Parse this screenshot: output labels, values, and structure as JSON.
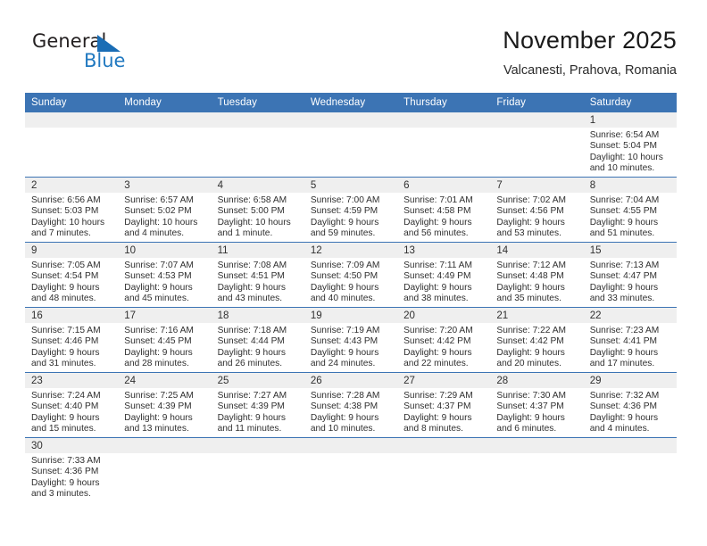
{
  "brand": {
    "name_line1": "General",
    "name_line2": "Blue",
    "mark": "triangle-flag-icon",
    "accent_color": "#2179c0"
  },
  "header": {
    "title": "November 2025",
    "location": "Valcanesti, Prahova, Romania"
  },
  "colors": {
    "header_blue": "#3c74b4",
    "daynum_strip": "#efefef",
    "text": "#2f2f2f"
  },
  "calendar": {
    "weekday_headers": [
      "Sunday",
      "Monday",
      "Tuesday",
      "Wednesday",
      "Thursday",
      "Friday",
      "Saturday"
    ],
    "labels": {
      "sunrise": "Sunrise:",
      "sunset": "Sunset:",
      "daylight": "Daylight:"
    },
    "weeks": [
      [
        {
          "day": "",
          "empty": true
        },
        {
          "day": "",
          "empty": true
        },
        {
          "day": "",
          "empty": true
        },
        {
          "day": "",
          "empty": true
        },
        {
          "day": "",
          "empty": true
        },
        {
          "day": "",
          "empty": true
        },
        {
          "day": "1",
          "sunrise": "Sunrise: 6:54 AM",
          "sunset": "Sunset: 5:04 PM",
          "daylight": "Daylight: 10 hours and 10 minutes."
        }
      ],
      [
        {
          "day": "2",
          "sunrise": "Sunrise: 6:56 AM",
          "sunset": "Sunset: 5:03 PM",
          "daylight": "Daylight: 10 hours and 7 minutes."
        },
        {
          "day": "3",
          "sunrise": "Sunrise: 6:57 AM",
          "sunset": "Sunset: 5:02 PM",
          "daylight": "Daylight: 10 hours and 4 minutes."
        },
        {
          "day": "4",
          "sunrise": "Sunrise: 6:58 AM",
          "sunset": "Sunset: 5:00 PM",
          "daylight": "Daylight: 10 hours and 1 minute."
        },
        {
          "day": "5",
          "sunrise": "Sunrise: 7:00 AM",
          "sunset": "Sunset: 4:59 PM",
          "daylight": "Daylight: 9 hours and 59 minutes."
        },
        {
          "day": "6",
          "sunrise": "Sunrise: 7:01 AM",
          "sunset": "Sunset: 4:58 PM",
          "daylight": "Daylight: 9 hours and 56 minutes."
        },
        {
          "day": "7",
          "sunrise": "Sunrise: 7:02 AM",
          "sunset": "Sunset: 4:56 PM",
          "daylight": "Daylight: 9 hours and 53 minutes."
        },
        {
          "day": "8",
          "sunrise": "Sunrise: 7:04 AM",
          "sunset": "Sunset: 4:55 PM",
          "daylight": "Daylight: 9 hours and 51 minutes."
        }
      ],
      [
        {
          "day": "9",
          "sunrise": "Sunrise: 7:05 AM",
          "sunset": "Sunset: 4:54 PM",
          "daylight": "Daylight: 9 hours and 48 minutes."
        },
        {
          "day": "10",
          "sunrise": "Sunrise: 7:07 AM",
          "sunset": "Sunset: 4:53 PM",
          "daylight": "Daylight: 9 hours and 45 minutes."
        },
        {
          "day": "11",
          "sunrise": "Sunrise: 7:08 AM",
          "sunset": "Sunset: 4:51 PM",
          "daylight": "Daylight: 9 hours and 43 minutes."
        },
        {
          "day": "12",
          "sunrise": "Sunrise: 7:09 AM",
          "sunset": "Sunset: 4:50 PM",
          "daylight": "Daylight: 9 hours and 40 minutes."
        },
        {
          "day": "13",
          "sunrise": "Sunrise: 7:11 AM",
          "sunset": "Sunset: 4:49 PM",
          "daylight": "Daylight: 9 hours and 38 minutes."
        },
        {
          "day": "14",
          "sunrise": "Sunrise: 7:12 AM",
          "sunset": "Sunset: 4:48 PM",
          "daylight": "Daylight: 9 hours and 35 minutes."
        },
        {
          "day": "15",
          "sunrise": "Sunrise: 7:13 AM",
          "sunset": "Sunset: 4:47 PM",
          "daylight": "Daylight: 9 hours and 33 minutes."
        }
      ],
      [
        {
          "day": "16",
          "sunrise": "Sunrise: 7:15 AM",
          "sunset": "Sunset: 4:46 PM",
          "daylight": "Daylight: 9 hours and 31 minutes."
        },
        {
          "day": "17",
          "sunrise": "Sunrise: 7:16 AM",
          "sunset": "Sunset: 4:45 PM",
          "daylight": "Daylight: 9 hours and 28 minutes."
        },
        {
          "day": "18",
          "sunrise": "Sunrise: 7:18 AM",
          "sunset": "Sunset: 4:44 PM",
          "daylight": "Daylight: 9 hours and 26 minutes."
        },
        {
          "day": "19",
          "sunrise": "Sunrise: 7:19 AM",
          "sunset": "Sunset: 4:43 PM",
          "daylight": "Daylight: 9 hours and 24 minutes."
        },
        {
          "day": "20",
          "sunrise": "Sunrise: 7:20 AM",
          "sunset": "Sunset: 4:42 PM",
          "daylight": "Daylight: 9 hours and 22 minutes."
        },
        {
          "day": "21",
          "sunrise": "Sunrise: 7:22 AM",
          "sunset": "Sunset: 4:42 PM",
          "daylight": "Daylight: 9 hours and 20 minutes."
        },
        {
          "day": "22",
          "sunrise": "Sunrise: 7:23 AM",
          "sunset": "Sunset: 4:41 PM",
          "daylight": "Daylight: 9 hours and 17 minutes."
        }
      ],
      [
        {
          "day": "23",
          "sunrise": "Sunrise: 7:24 AM",
          "sunset": "Sunset: 4:40 PM",
          "daylight": "Daylight: 9 hours and 15 minutes."
        },
        {
          "day": "24",
          "sunrise": "Sunrise: 7:25 AM",
          "sunset": "Sunset: 4:39 PM",
          "daylight": "Daylight: 9 hours and 13 minutes."
        },
        {
          "day": "25",
          "sunrise": "Sunrise: 7:27 AM",
          "sunset": "Sunset: 4:39 PM",
          "daylight": "Daylight: 9 hours and 11 minutes."
        },
        {
          "day": "26",
          "sunrise": "Sunrise: 7:28 AM",
          "sunset": "Sunset: 4:38 PM",
          "daylight": "Daylight: 9 hours and 10 minutes."
        },
        {
          "day": "27",
          "sunrise": "Sunrise: 7:29 AM",
          "sunset": "Sunset: 4:37 PM",
          "daylight": "Daylight: 9 hours and 8 minutes."
        },
        {
          "day": "28",
          "sunrise": "Sunrise: 7:30 AM",
          "sunset": "Sunset: 4:37 PM",
          "daylight": "Daylight: 9 hours and 6 minutes."
        },
        {
          "day": "29",
          "sunrise": "Sunrise: 7:32 AM",
          "sunset": "Sunset: 4:36 PM",
          "daylight": "Daylight: 9 hours and 4 minutes."
        }
      ],
      [
        {
          "day": "30",
          "sunrise": "Sunrise: 7:33 AM",
          "sunset": "Sunset: 4:36 PM",
          "daylight": "Daylight: 9 hours and 3 minutes."
        },
        {
          "day": "",
          "empty": true
        },
        {
          "day": "",
          "empty": true
        },
        {
          "day": "",
          "empty": true
        },
        {
          "day": "",
          "empty": true
        },
        {
          "day": "",
          "empty": true
        },
        {
          "day": "",
          "empty": true
        }
      ]
    ]
  }
}
